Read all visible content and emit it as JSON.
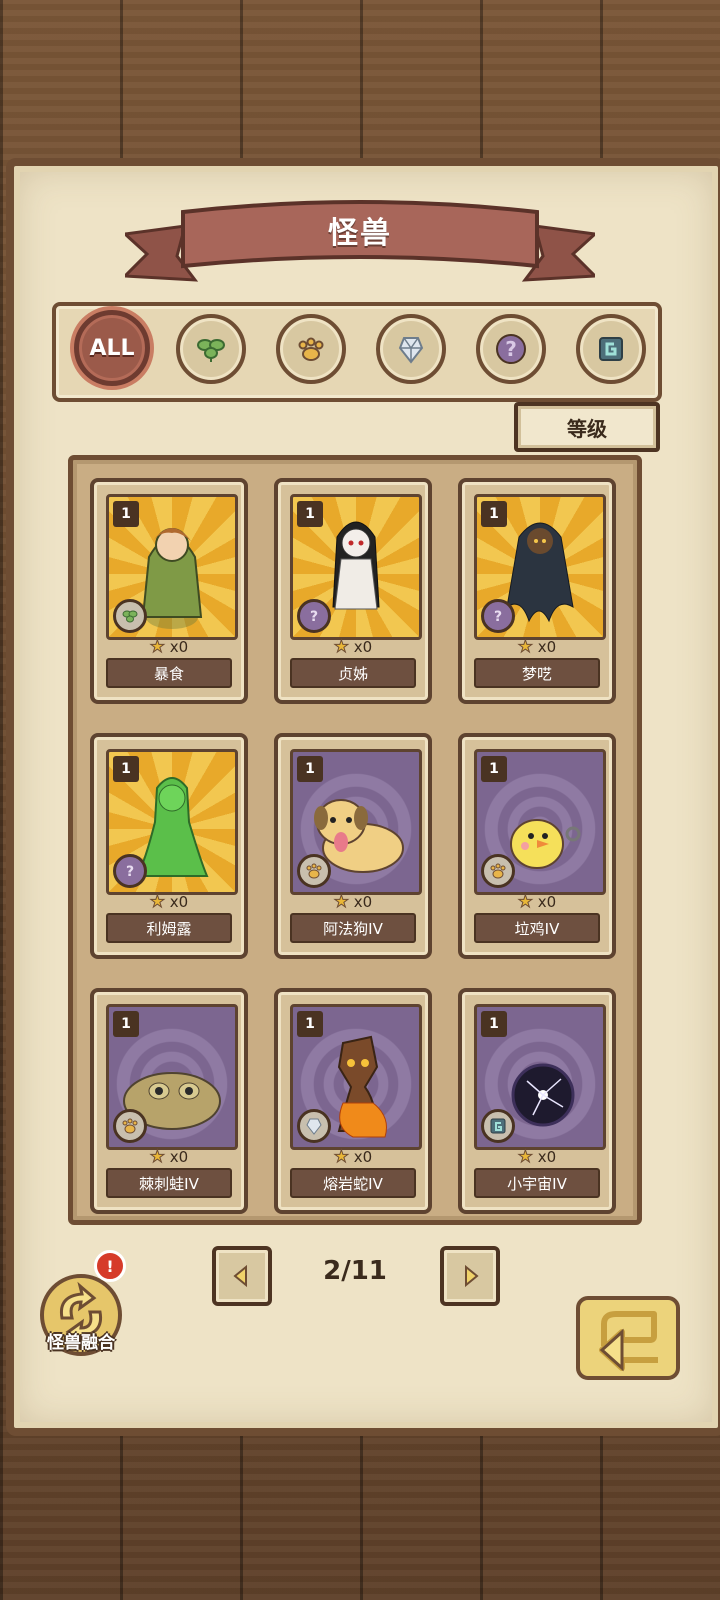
{
  "header": {
    "title": "怪兽"
  },
  "filters": [
    {
      "id": "all",
      "label": "ALL",
      "icon": "all-icon",
      "active": true
    },
    {
      "id": "plant",
      "icon": "leaf-icon"
    },
    {
      "id": "beast",
      "icon": "paw-icon"
    },
    {
      "id": "mineral",
      "icon": "crystal-icon"
    },
    {
      "id": "unknown",
      "icon": "question-icon"
    },
    {
      "id": "cosmic",
      "icon": "cosmic-icon"
    }
  ],
  "sort": {
    "label": "等级"
  },
  "cards": [
    {
      "name": "暴食",
      "level": "1",
      "count": "x0",
      "bg": "gold",
      "type": "leaf-icon"
    },
    {
      "name": "贞姊",
      "level": "1",
      "count": "x0",
      "bg": "gold",
      "type": "question-icon"
    },
    {
      "name": "梦呓",
      "level": "1",
      "count": "x0",
      "bg": "gold",
      "type": "question-icon"
    },
    {
      "name": "利姆露",
      "level": "1",
      "count": "x0",
      "bg": "gold",
      "type": "question-icon"
    },
    {
      "name": "阿法狗IV",
      "level": "1",
      "count": "x0",
      "bg": "purple",
      "type": "paw-icon"
    },
    {
      "name": "垃鸡IV",
      "level": "1",
      "count": "x0",
      "bg": "purple",
      "type": "paw-icon"
    },
    {
      "name": "棘刺蛙IV",
      "level": "1",
      "count": "x0",
      "bg": "purple",
      "type": "paw-icon"
    },
    {
      "name": "熔岩蛇IV",
      "level": "1",
      "count": "x0",
      "bg": "purple",
      "type": "crystal-icon"
    },
    {
      "name": "小宇宙IV",
      "level": "1",
      "count": "x0",
      "bg": "purple",
      "type": "cosmic-icon"
    }
  ],
  "pager": {
    "indicator": "2/11",
    "current": 2,
    "total": 11
  },
  "fusion": {
    "label": "怪兽融合",
    "alert": "!"
  },
  "colors": {
    "paper": "#eee3c6",
    "frame": "#6e4d33",
    "ribbon": "#a8665a",
    "accent": "#e9b738"
  }
}
